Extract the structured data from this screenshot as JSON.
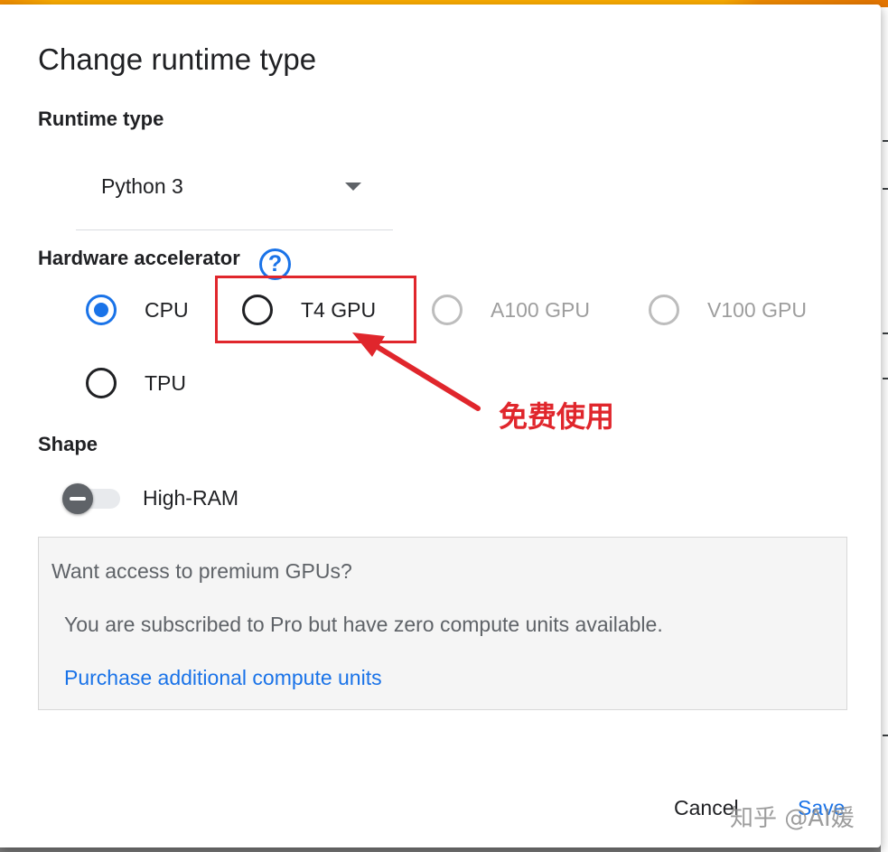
{
  "dialog": {
    "title": "Change runtime type",
    "runtime_type": {
      "label": "Runtime type",
      "selected": "Python 3"
    },
    "hardware_accelerator": {
      "label": "Hardware accelerator",
      "help_icon": "question-mark-icon",
      "options": [
        {
          "label": "CPU",
          "state": "selected"
        },
        {
          "label": "T4 GPU",
          "state": "enabled"
        },
        {
          "label": "A100 GPU",
          "state": "disabled"
        },
        {
          "label": "V100 GPU",
          "state": "disabled"
        },
        {
          "label": "TPU",
          "state": "enabled"
        }
      ]
    },
    "shape": {
      "label": "Shape",
      "toggle_label": "High-RAM",
      "toggle_on": false
    },
    "premium": {
      "heading": "Want access to premium GPUs?",
      "message": "You are subscribed to Pro but have zero compute units available.",
      "link": "Purchase additional compute units"
    },
    "buttons": {
      "cancel": "Cancel",
      "save": "Save"
    }
  },
  "annotation": {
    "text": "免费使用",
    "color": "#e0262c"
  },
  "watermark": "知乎 @AI媛",
  "colors": {
    "accent": "#1a73e8",
    "top_bar": "#f9ab00",
    "annotation": "#e0262c"
  }
}
